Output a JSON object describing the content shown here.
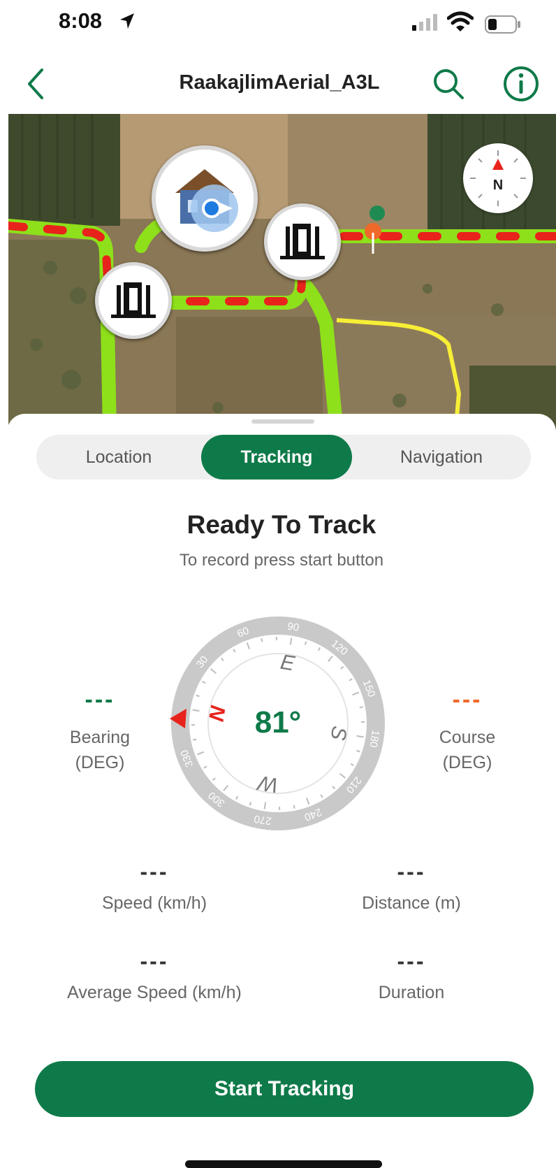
{
  "status_bar": {
    "time": "8:08"
  },
  "header": {
    "title": "RaakajlimAerial_A3L"
  },
  "map": {
    "compass_letter": "N"
  },
  "tabs": [
    {
      "label": "Location",
      "active": false
    },
    {
      "label": "Tracking",
      "active": true
    },
    {
      "label": "Navigation",
      "active": false
    }
  ],
  "tracking": {
    "status_title": "Ready To Track",
    "status_hint": "To record press start button",
    "heading_value": "81°",
    "compass_ticks": [
      "30",
      "60",
      "90",
      "120",
      "150",
      "180",
      "210",
      "240",
      "270",
      "300",
      "330"
    ],
    "compass_letters": {
      "n": "N",
      "e": "E",
      "s": "S",
      "w": "W"
    },
    "bearing": {
      "value": "---",
      "label_line1": "Bearing",
      "label_line2": "(DEG)"
    },
    "course": {
      "value": "---",
      "label_line1": "Course",
      "label_line2": "(DEG)"
    },
    "speed": {
      "value": "---",
      "label": "Speed (km/h)"
    },
    "distance": {
      "value": "---",
      "label": "Distance (m)"
    },
    "avg_speed": {
      "value": "---",
      "label": "Average Speed (km/h)"
    },
    "duration": {
      "value": "---",
      "label": "Duration"
    }
  },
  "start_button": {
    "label": "Start Tracking"
  },
  "colors": {
    "brand_green": "#0f7a49",
    "bearing_dash": "#0f7a49",
    "course_dash": "#ef6a2a",
    "route_green": "#8ee01a",
    "route_red_dash": "#e8231c",
    "route_yellow": "#f7ee36"
  }
}
